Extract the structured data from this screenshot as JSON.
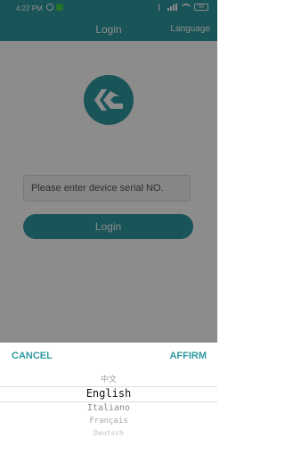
{
  "status_bar": {
    "time": "4:22 PM",
    "battery": "89",
    "icons": [
      "alarm-icon",
      "notification-icon",
      "bluetooth-icon",
      "signal-icon",
      "wifi-icon",
      "battery-icon"
    ]
  },
  "title_bar": {
    "title": "Login",
    "language_label": "Language"
  },
  "login_form": {
    "serial_placeholder": "Please enter device serial NO.",
    "login_button": "Login"
  },
  "picker_sheet": {
    "cancel_label": "CANCEL",
    "affirm_label": "AFFIRM",
    "options": [
      "中文",
      "English",
      "Italiano",
      "Français",
      "Deutsch"
    ],
    "selected": "English"
  },
  "colors": {
    "accent": "#2f9aa0",
    "overlay": "rgba(0,0,0,0.45)"
  }
}
